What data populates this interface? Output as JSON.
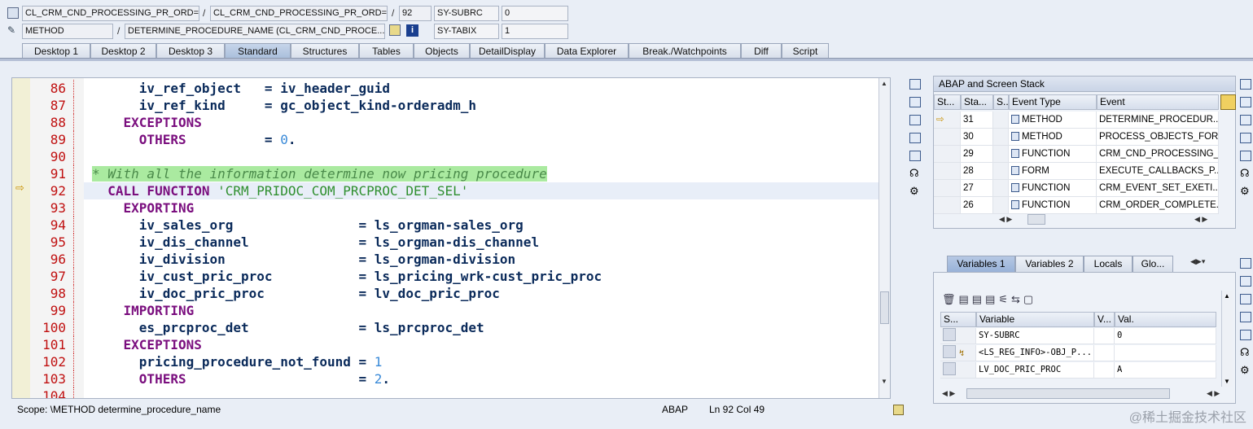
{
  "header": {
    "row1": {
      "program": "CL_CRM_CND_PROCESSING_PR_ORD=...",
      "include": "CL_CRM_CND_PROCESSING_PR_ORD=...",
      "line": "92",
      "sysvar1_name": "SY-SUBRC",
      "sysvar1_value": "0"
    },
    "row2": {
      "type": "METHOD",
      "name": "DETERMINE_PROCEDURE_NAME (CL_CRM_CND_PROCE...",
      "sysvar2_name": "SY-TABIX",
      "sysvar2_value": "1"
    },
    "separator": "/"
  },
  "tabs": [
    "Desktop 1",
    "Desktop 2",
    "Desktop 3",
    "Standard",
    "Structures",
    "Tables",
    "Objects",
    "DetailDisplay",
    "Data Explorer",
    "Break./Watchpoints",
    "Diff",
    "Script"
  ],
  "active_tab": "Standard",
  "editor": {
    "lines": [
      {
        "n": "86",
        "text": "      iv_ref_object   = iv_header_guid"
      },
      {
        "n": "87",
        "text": "      iv_ref_kind     = gc_object_kind-orderadm_h"
      },
      {
        "n": "88",
        "kw": "    EXCEPTIONS"
      },
      {
        "n": "89",
        "kw": "      OTHERS",
        "text": "          = ",
        "num": "0",
        "tail": "."
      },
      {
        "n": "90",
        "text": ""
      },
      {
        "n": "91",
        "comment": "* With all the information determine now pricing procedure"
      },
      {
        "n": "92",
        "kw": "  CALL FUNCTION",
        "str": " 'CRM_PRIDOC_COM_PRCPROC_DET_SEL'"
      },
      {
        "n": "93",
        "kw": "    EXPORTING"
      },
      {
        "n": "94",
        "text": "      iv_sales_org                = ls_orgman-sales_org"
      },
      {
        "n": "95",
        "text": "      iv_dis_channel              = ls_orgman-dis_channel"
      },
      {
        "n": "96",
        "text": "      iv_division                 = ls_orgman-division"
      },
      {
        "n": "97",
        "text": "      iv_cust_pric_proc           = ls_pricing_wrk-cust_pric_proc"
      },
      {
        "n": "98",
        "text": "      iv_doc_pric_proc            = lv_doc_pric_proc"
      },
      {
        "n": "99",
        "kw": "    IMPORTING"
      },
      {
        "n": "100",
        "text": "      es_prcproc_det              = ls_prcproc_det"
      },
      {
        "n": "101",
        "kw": "    EXCEPTIONS"
      },
      {
        "n": "102",
        "text": "      pricing_procedure_not_found = ",
        "num": "1"
      },
      {
        "n": "103",
        "kw": "      OTHERS",
        "text": "                      = ",
        "num": "2",
        "tail": "."
      },
      {
        "n": "104",
        "text": ""
      }
    ]
  },
  "status": {
    "scope": "Scope: \\METHOD determine_procedure_name",
    "lang": "ABAP",
    "position": "Ln  92 Col  49"
  },
  "stack": {
    "title": "ABAP and Screen Stack",
    "columns": [
      "St...",
      "Sta...",
      "S...",
      "Event Type",
      "Event"
    ],
    "rows": [
      {
        "level": "31",
        "type": "METHOD",
        "event": "DETERMINE_PROCEDUR...",
        "current": true
      },
      {
        "level": "30",
        "type": "METHOD",
        "event": "PROCESS_OBJECTS_FOR_..."
      },
      {
        "level": "29",
        "type": "FUNCTION",
        "event": "CRM_CND_PROCESSING_..."
      },
      {
        "level": "28",
        "type": "FORM",
        "event": "EXECUTE_CALLBACKS_P..."
      },
      {
        "level": "27",
        "type": "FUNCTION",
        "event": "CRM_EVENT_SET_EXETI..."
      },
      {
        "level": "26",
        "type": "FUNCTION",
        "event": "CRM_ORDER_COMPLETE..."
      }
    ]
  },
  "variables": {
    "tabs": [
      "Variables 1",
      "Variables 2",
      "Locals",
      "Glo..."
    ],
    "columns": [
      "S...",
      "Variable",
      "V...",
      "Val."
    ],
    "rows": [
      {
        "name": "SY-SUBRC",
        "value": "0"
      },
      {
        "name": "<LS_REG_INFO>-OBJ_P...",
        "value": ""
      },
      {
        "name": "LV_DOC_PRIC_PROC",
        "value": "A"
      }
    ]
  },
  "watermark": "@稀土掘金技术社区",
  "colors": {
    "accent": "#a9bedb",
    "keyword": "#7a0e7e",
    "lineno": "#c01010",
    "comment_bg": "#aaeaa0"
  }
}
